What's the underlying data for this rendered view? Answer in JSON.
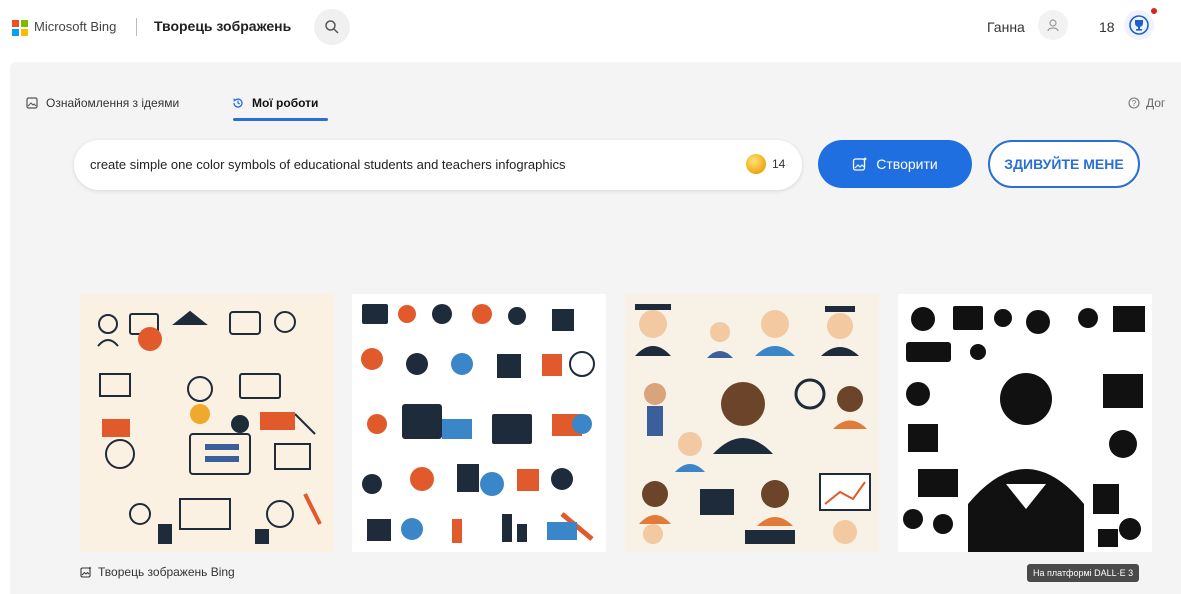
{
  "header": {
    "brand": "Microsoft Bing",
    "product": "Творець зображень",
    "user_name": "Ганна",
    "reward_count": "18",
    "logo_colors": [
      "#f25022",
      "#7fba00",
      "#00a4ef",
      "#ffb900"
    ]
  },
  "tabs": [
    {
      "label": "Ознайомлення з ідеями",
      "icon": "image-icon"
    },
    {
      "label": "Мої роботи",
      "icon": "history-icon"
    }
  ],
  "help_label": "Дог",
  "prompt": {
    "value": "create simple one color symbols of educational students and teachers infographics",
    "boost_count": "14"
  },
  "buttons": {
    "create_label": "Створити",
    "surprise_label": "ЗДИВУЙТЕ МЕНЕ"
  },
  "gallery": {
    "images": [
      {
        "name": "generated-image-1",
        "style": "colorful-icons"
      },
      {
        "name": "generated-image-2",
        "style": "colorful-icons"
      },
      {
        "name": "generated-image-3",
        "style": "people-portraits"
      },
      {
        "name": "generated-image-4",
        "style": "black-silhouettes"
      }
    ]
  },
  "footer": {
    "brand_label": "Творець зображень Bing",
    "badge": "На платформі DALL·E 3"
  },
  "colors": {
    "accent": "#1f6fe0",
    "page_bg": "#f4f4f4"
  }
}
